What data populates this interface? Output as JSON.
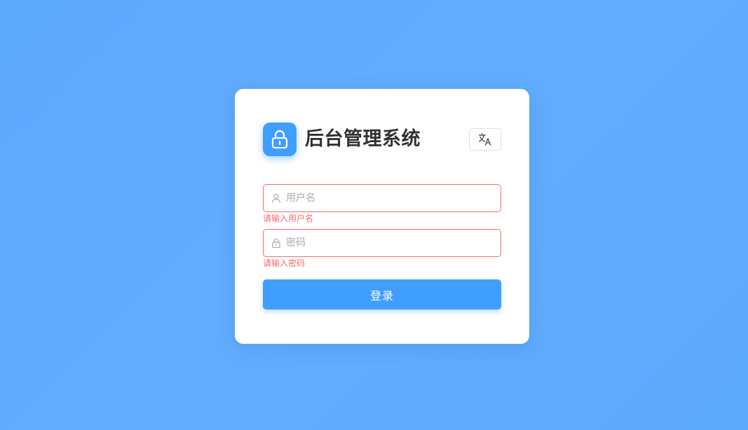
{
  "header": {
    "title": "后台管理系统",
    "logo_icon": "lock-icon",
    "language_icon": "translate-icon"
  },
  "form": {
    "username": {
      "value": "",
      "placeholder": "用户名",
      "icon": "user-icon",
      "error": "请输入用户名"
    },
    "password": {
      "value": "",
      "placeholder": "密码",
      "icon": "lock-icon",
      "error": "请输入密码"
    },
    "submit_label": "登录"
  },
  "colors": {
    "background": "#5eaafd",
    "primary": "#409eff",
    "error": "#f56c6c",
    "title": "#303133"
  }
}
